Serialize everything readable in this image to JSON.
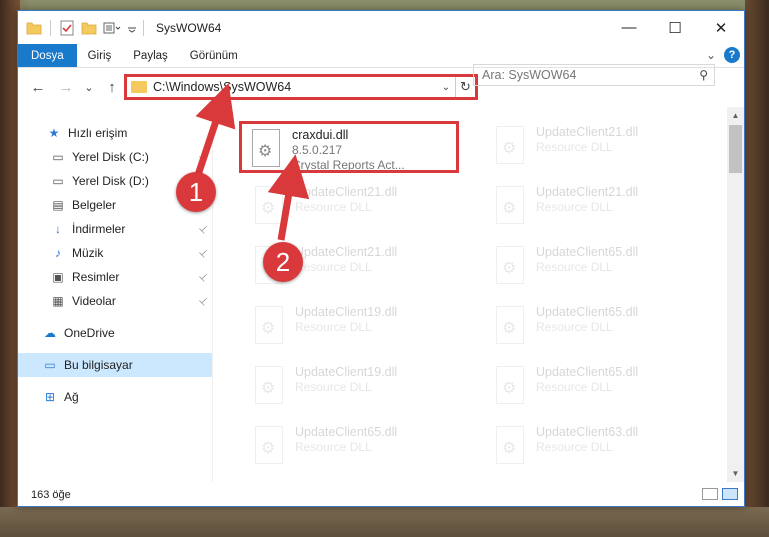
{
  "window": {
    "title": "SysWOW64",
    "controls": {
      "minimize": "—",
      "maximize": "☐",
      "close": "✕"
    }
  },
  "ribbon": {
    "tabs": [
      "Dosya",
      "Giriş",
      "Paylaş",
      "Görünüm"
    ],
    "collapse_glyph": "⌄",
    "help_glyph": "?"
  },
  "navigation": {
    "back_glyph": "←",
    "forward_glyph": "→",
    "recent_glyph": "⌄",
    "up_glyph": "↑",
    "address": "C:\\Windows\\SysWOW64",
    "dropdown_glyph": "⌄",
    "refresh_glyph": "↻",
    "search_placeholder": "Ara: SysWOW64",
    "search_glyph": "⚲"
  },
  "sidebar": {
    "items": [
      {
        "label": "Hızlı erişim",
        "icon": "star-icon",
        "glyph": "★",
        "color": "#2d7bd4",
        "pinned": false,
        "indent": 28
      },
      {
        "label": "Yerel Disk (C:)",
        "icon": "drive-icon",
        "glyph": "▭",
        "color": "#555555",
        "pinned": true,
        "indent": 32
      },
      {
        "label": "Yerel Disk (D:)",
        "icon": "drive-icon",
        "glyph": "▭",
        "color": "#555555",
        "pinned": false,
        "indent": 32
      },
      {
        "label": "Belgeler",
        "icon": "document-icon",
        "glyph": "▤",
        "color": "#555555",
        "pinned": false,
        "indent": 32
      },
      {
        "label": "İndirmeler",
        "icon": "download-icon",
        "glyph": "↓",
        "color": "#2d7bd4",
        "pinned": true,
        "indent": 32
      },
      {
        "label": "Müzik",
        "icon": "music-icon",
        "glyph": "♪",
        "color": "#2d7bd4",
        "pinned": true,
        "indent": 32
      },
      {
        "label": "Resimler",
        "icon": "pictures-icon",
        "glyph": "▣",
        "color": "#555555",
        "pinned": true,
        "indent": 32
      },
      {
        "label": "Videolar",
        "icon": "video-icon",
        "glyph": "▦",
        "color": "#555555",
        "pinned": true,
        "indent": 32
      },
      {
        "label": "OneDrive",
        "icon": "cloud-icon",
        "glyph": "☁",
        "color": "#1979ca",
        "pinned": false,
        "indent": 24
      },
      {
        "label": "Bu bilgisayar",
        "icon": "computer-icon",
        "glyph": "▭",
        "color": "#2d7bd4",
        "pinned": false,
        "indent": 24,
        "selected": true
      },
      {
        "label": "Ağ",
        "icon": "network-icon",
        "glyph": "⊞",
        "color": "#2d7bd4",
        "pinned": false,
        "indent": 24
      }
    ],
    "pin_glyph": "📌"
  },
  "files": {
    "highlighted": {
      "name": "craxdui.dll",
      "version": "8.5.0.217",
      "description": "Crystal Reports Act..."
    },
    "faded": [
      {
        "name": "UpdateClient21.dll",
        "type": "Resource DLL"
      },
      {
        "name": "UpdateClient21.dll",
        "type": "Resource DLL"
      },
      {
        "name": "UpdateClient21.dll",
        "type": "Resource DLL"
      },
      {
        "name": "UpdateClient21.dll",
        "type": "Resource DLL"
      },
      {
        "name": "UpdateClient65.dll",
        "type": "Resource DLL"
      },
      {
        "name": "UpdateClient19.dll",
        "type": "Resource DLL"
      },
      {
        "name": "UpdateClient65.dll",
        "type": "Resource DLL"
      },
      {
        "name": "UpdateClient19.dll",
        "type": "Resource DLL"
      },
      {
        "name": "UpdateClient65.dll",
        "type": "Resource DLL"
      },
      {
        "name": "UpdateClient65.dll",
        "type": "Resource DLL"
      },
      {
        "name": "UpdateClient63.dll",
        "type": "Resource DLL"
      }
    ]
  },
  "status": {
    "item_count": "163 öğe"
  },
  "callouts": {
    "one": "1",
    "two": "2"
  },
  "colors": {
    "accent": "#1979ca",
    "highlight": "#d9393a"
  }
}
